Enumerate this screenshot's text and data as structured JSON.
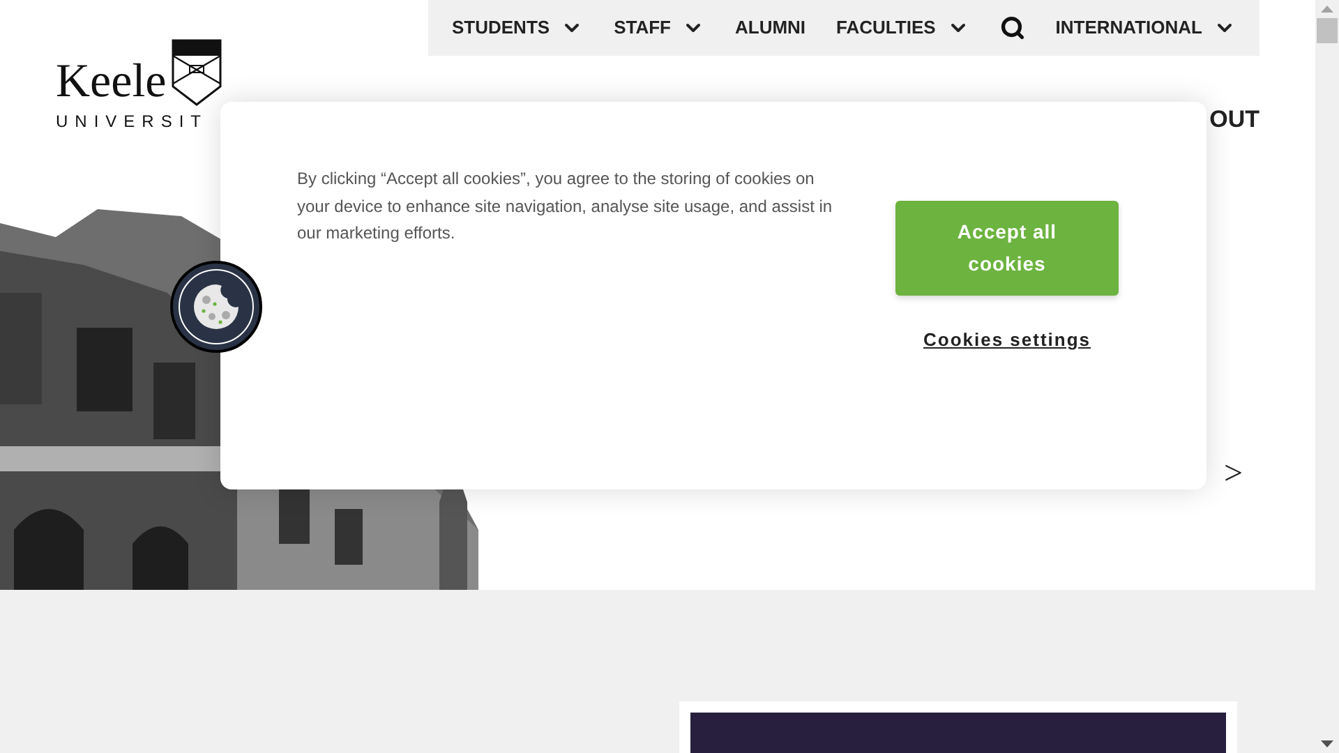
{
  "logo": {
    "wordmark": "Keele",
    "subtitle": "UNIVERSIT"
  },
  "nav": [
    {
      "kind": "link",
      "label": "STUDENTS",
      "dropdown": true
    },
    {
      "kind": "link",
      "label": "STAFF",
      "dropdown": true
    },
    {
      "kind": "link",
      "label": "ALUMNI",
      "dropdown": false
    },
    {
      "kind": "link",
      "label": "FACULTIES",
      "dropdown": true
    },
    {
      "kind": "search"
    },
    {
      "kind": "link",
      "label": "INTERNATIONAL",
      "dropdown": true
    }
  ],
  "main_nav_fragment": "OUT",
  "hero": {
    "link_arrow": ">"
  },
  "cookie_banner": {
    "message": "By clicking “Accept all cookies”, you agree to the storing of cookies on your device to enhance site navigation, analyse site usage, and assist in our marketing efforts.",
    "accept_button": "Accept all cookies",
    "settings_link": "Cookies settings"
  }
}
